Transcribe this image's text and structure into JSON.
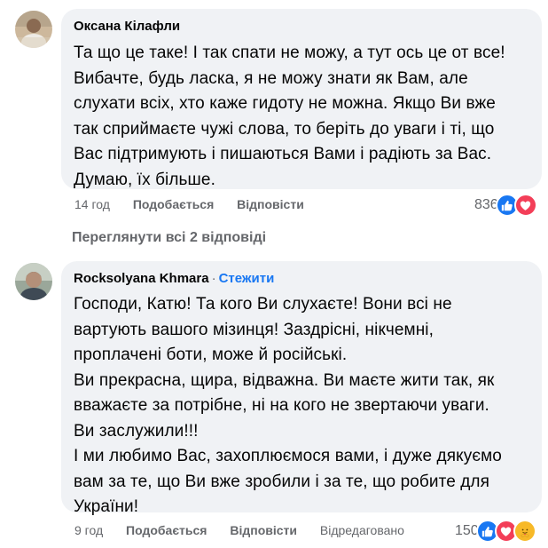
{
  "comments": [
    {
      "author": "Оксана Кілафли",
      "text": "Та що це таке! І так спати не можу, а тут ось це от все!\nВибачте, будь ласка, я не можу знати як Вам, але\nслухати всіх, хто каже гидоту не можна. Якщо Ви вже\nтак сприймаєте чужі слова, то беріть до уваги і ті, що\nВас підтримують і пишаються Вами і радіють за Вас.\nДумаю, їх більше.",
      "time": "14 год",
      "like_label": "Подобається",
      "reply_label": "Відповісти",
      "reaction_count": "836",
      "reactions": [
        "like-icon",
        "love-icon"
      ]
    },
    {
      "author": "Rocksolyana Khmara",
      "separator": "·",
      "follow_label": "Стежити",
      "text": "Господи, Катю! Та кого Ви слухаєте! Вони всі не\nвартують вашого мізинця! Заздрісні, нікчемні,\nпроплачені боти, може й російські.\nВи прекрасна, щира, відважна. Ви маєте жити так, як\nвважаєте за потрібне, ні на кого не звертаючи уваги.\nВи заслужили!!!\nІ ми любимо Вас, захоплюємося вами, і дуже дякуємо\nвам за те, що Ви вже зробили і за те, що робите для\nУкраїни!",
      "time": "9 год",
      "like_label": "Подобається",
      "reply_label": "Відповісти",
      "edited_label": "Відредаговано",
      "reaction_count": "150",
      "reactions": [
        "like-icon",
        "love-icon",
        "care-icon"
      ]
    }
  ],
  "view_replies_label": "Переглянути всі 2 відповіді",
  "colors": {
    "bubble": "#f0f2f5",
    "meta": "#65676b",
    "link": "#1877f2",
    "like": "#1877f2",
    "love": "#f33e58",
    "care": "#f7b928"
  }
}
